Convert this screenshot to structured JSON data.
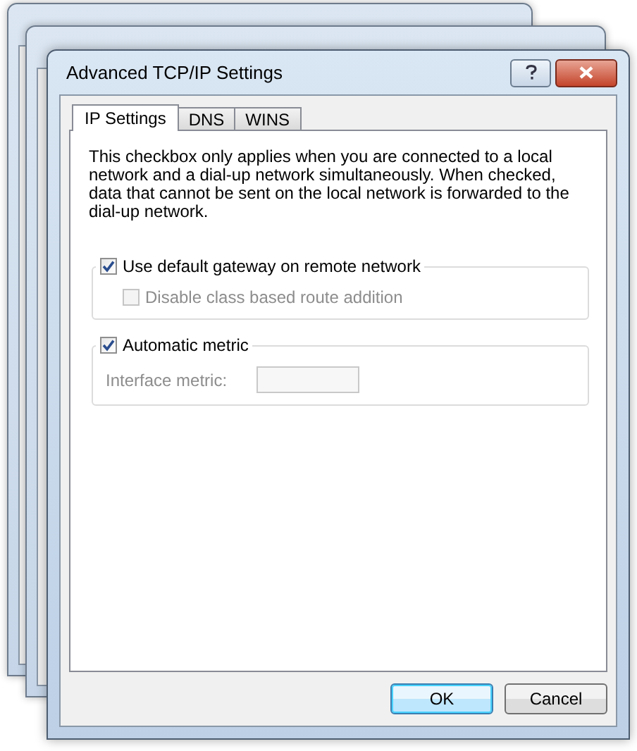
{
  "window": {
    "title": "Advanced TCP/IP Settings"
  },
  "tabs": [
    {
      "label": "IP Settings",
      "selected": true
    },
    {
      "label": "DNS",
      "selected": false
    },
    {
      "label": "WINS",
      "selected": false
    }
  ],
  "description": "This checkbox only applies when you are connected to a local network and a dial-up network simultaneously.  When checked, data that cannot be sent on the local network is forwarded to the dial-up network.",
  "groups": [
    {
      "checkbox": {
        "label": "Use default gateway on remote network",
        "checked": true
      },
      "options": [
        {
          "kind": "checkbox",
          "label": "Disable class based route addition",
          "checked": false,
          "disabled": true
        }
      ]
    },
    {
      "checkbox": {
        "label": "Automatic metric",
        "checked": true
      },
      "options": [
        {
          "kind": "field",
          "label": "Interface metric:",
          "disabled": true
        }
      ]
    }
  ],
  "buttons": [
    {
      "label": "OK",
      "default": true
    },
    {
      "label": "Cancel",
      "default": false
    }
  ]
}
